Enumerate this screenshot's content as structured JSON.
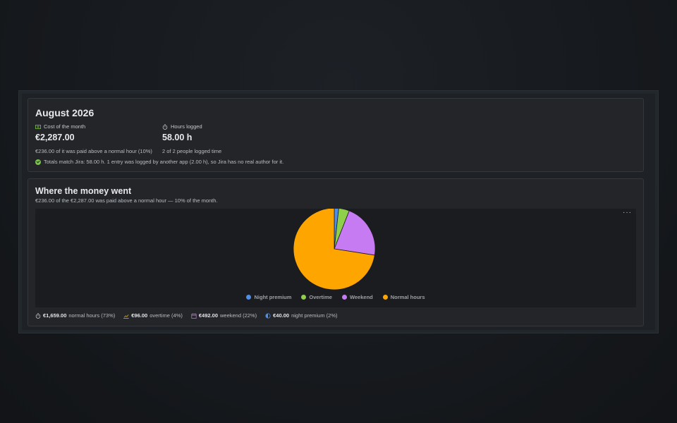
{
  "summary": {
    "title": "August 2026",
    "cost": {
      "icon": "money-icon",
      "label": "Cost of the month",
      "value": "€2,287.00",
      "note": "€236.00 of it was paid above a normal hour (10%)"
    },
    "hours": {
      "icon": "stopwatch-icon",
      "label": "Hours logged",
      "value": "58.00 h",
      "note": "2 of 2 people logged time"
    },
    "match": {
      "icon": "check-circle-icon",
      "text": "Totals match Jira: 58.00 h. 1 entry was logged by another app (2.00 h), so Jira has no real author for it."
    }
  },
  "money": {
    "title": "Where the money went",
    "subtitle": "€236.00 of the €2,287.00 was paid above a normal hour — 10% of the month.",
    "more_label": "···",
    "breakdown": [
      {
        "icon": "stopwatch-icon",
        "amount": "€1,659.00",
        "text": "normal hours (73%)",
        "color": "#c9cdd2"
      },
      {
        "icon": "trend-up-icon",
        "amount": "€96.00",
        "text": "overtime (4%)",
        "color": "#e0b33a"
      },
      {
        "icon": "calendar-icon",
        "amount": "€492.00",
        "text": "weekend (22%)",
        "color": "#c77bdc"
      },
      {
        "icon": "half-moon-icon",
        "amount": "€40.00",
        "text": "night premium (2%)",
        "color": "#4f8de6"
      }
    ]
  },
  "chart_data": {
    "type": "pie",
    "categories": [
      "Night premium",
      "Overtime",
      "Weekend",
      "Normal hours"
    ],
    "values": [
      40,
      96,
      492,
      1659
    ],
    "colors": [
      "#4f8de6",
      "#8fcf4a",
      "#c77bf2",
      "#ffa500"
    ],
    "legend": "bottom"
  }
}
